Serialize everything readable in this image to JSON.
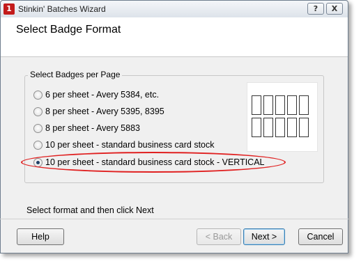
{
  "window": {
    "title": "Stinkin' Batches Wizard",
    "help_glyph": "?",
    "close_glyph": "X"
  },
  "header": {
    "page_title": "Select Badge Format"
  },
  "group": {
    "legend": "Select Badges per Page",
    "options": [
      {
        "label": "6 per sheet - Avery 5384, etc.",
        "checked": false
      },
      {
        "label": "8 per sheet - Avery 5395, 8395",
        "checked": false
      },
      {
        "label": "8 per sheet - Avery 5883",
        "checked": false
      },
      {
        "label": "10 per sheet - standard business card stock",
        "checked": false
      },
      {
        "label": "10 per sheet - standard business card stock - VERTICAL",
        "checked": true
      }
    ]
  },
  "status_text": "Select format and then click Next",
  "buttons": {
    "help": "Help",
    "back": "< Back",
    "next": "Next >",
    "cancel": "Cancel"
  },
  "colors": {
    "highlight": "#e02020",
    "app_icon": "#c31b1b"
  }
}
